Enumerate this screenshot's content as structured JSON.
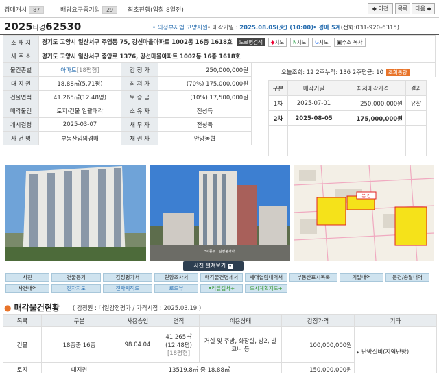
{
  "topbar": {
    "auction_list_label": "경매개시",
    "auction_list_count": "87",
    "dividend_label": "배당요구종기일",
    "dividend_count": "29",
    "first_round": "최초진행(입찰 8일전)",
    "prev_label": "◆ 이전",
    "list_label": "목록",
    "next_label": "다음 ◆"
  },
  "title": {
    "year": "2025",
    "type": "타경",
    "number": "62530",
    "court": "• 의정부지법 고양지원",
    "sale_date_label": "• 매각기일 :",
    "sale_date": "2025.08.05(火) (10:00)",
    "dept": "• 경매 5계",
    "phone": "(전화:031-920-6315)"
  },
  "info": {
    "address_label": "소 재 지",
    "address": "경기도 고양시 일산서구 주엽동 75, 강선마을아파트 1002동 16층 1618호",
    "road_btn": "도로명검색",
    "map_btns": [
      "지도",
      "지도",
      "지도",
      "주소 복사"
    ],
    "new_address_label": "새 주 소",
    "new_address": "경기도 고양시 일산서구 중앙로 1376, 강선마을아파트 1002동 16층 1618호",
    "rows": [
      {
        "l1": "물건종별",
        "v1": "아파트",
        "v1b": "[18평형]",
        "l2": "감 정 가",
        "v2": "250,000,000원"
      },
      {
        "l1": "대 지 권",
        "v1": "18.88㎡(5.71평)",
        "v1b": "",
        "l2": "최 저 가",
        "v2": "(70%) 175,000,000원"
      },
      {
        "l1": "건물면적",
        "v1": "41.265㎡(12.48평)",
        "v1b": "",
        "l2": "보 증 금",
        "v2": "(10%) 17,500,000원"
      },
      {
        "l1": "매각물건",
        "v1": "토지·건물 일괄매각",
        "v1b": "",
        "l2": "소 유 자",
        "v2": "전성득"
      },
      {
        "l1": "개시결정",
        "v1": "2025-03-07",
        "v1b": "",
        "l2": "채 무 자",
        "v2": "전성득"
      },
      {
        "l1": "사 건 명",
        "v1": "부동산임의경매",
        "v1b": "",
        "l2": "채 권 자",
        "v2": "안양농협"
      }
    ],
    "viewed": "오늘조회: 12  2주누적: 136  2주평균: 10",
    "viewed_btn": "조회동향"
  },
  "rounds": {
    "headers": [
      "구분",
      "매각기일",
      "최저매각가격",
      "결과"
    ],
    "rows": [
      [
        "1차",
        "2025-07-01",
        "250,000,000원",
        "유찰"
      ],
      [
        "2차",
        "2025-08-05",
        "175,000,000원",
        ""
      ]
    ]
  },
  "photo_btn": "사진 펼쳐보기",
  "quick_row1": [
    "사진",
    "건물등기",
    "감정평가서",
    "현황조사서",
    "매각물건명세서",
    "세대열람내역서",
    "부동산표시목록",
    "기일내역",
    "문건/송달내역"
  ],
  "quick_row2": [
    "사건내역",
    "전자지도",
    "전자지적도",
    "로드뷰",
    "•리얼캡처+",
    "도시계획지도+"
  ],
  "goods": {
    "title": "매각물건현황",
    "meta": "( 감정원 : 대일감정평가 / 가격시점 : 2025.03.19 )",
    "headers": [
      "목록",
      "구분",
      "사용승인",
      "면적",
      "이용상태",
      "감정가격",
      "기타"
    ],
    "row1": {
      "c1": "건물",
      "c2": "18층중 16층",
      "c3": "98.04.04",
      "c4a": "41.265㎡",
      "c4b": "(12.48평)",
      "c4c": "[18평형]",
      "c5": "거실 및 주방, 화장실, 방2, 발코니 등",
      "c6": "100,000,000원",
      "c7": "▸ 난방설비(지역난방)"
    },
    "row2": {
      "c1": "토지",
      "c2": "대지권",
      "c4": "13519.8㎡ 중 18.88㎡",
      "c6": "150,000,000원"
    }
  },
  "map_labels": {
    "pin": "본 건"
  },
  "photo_caption": "*이동주 : 감정평가사"
}
